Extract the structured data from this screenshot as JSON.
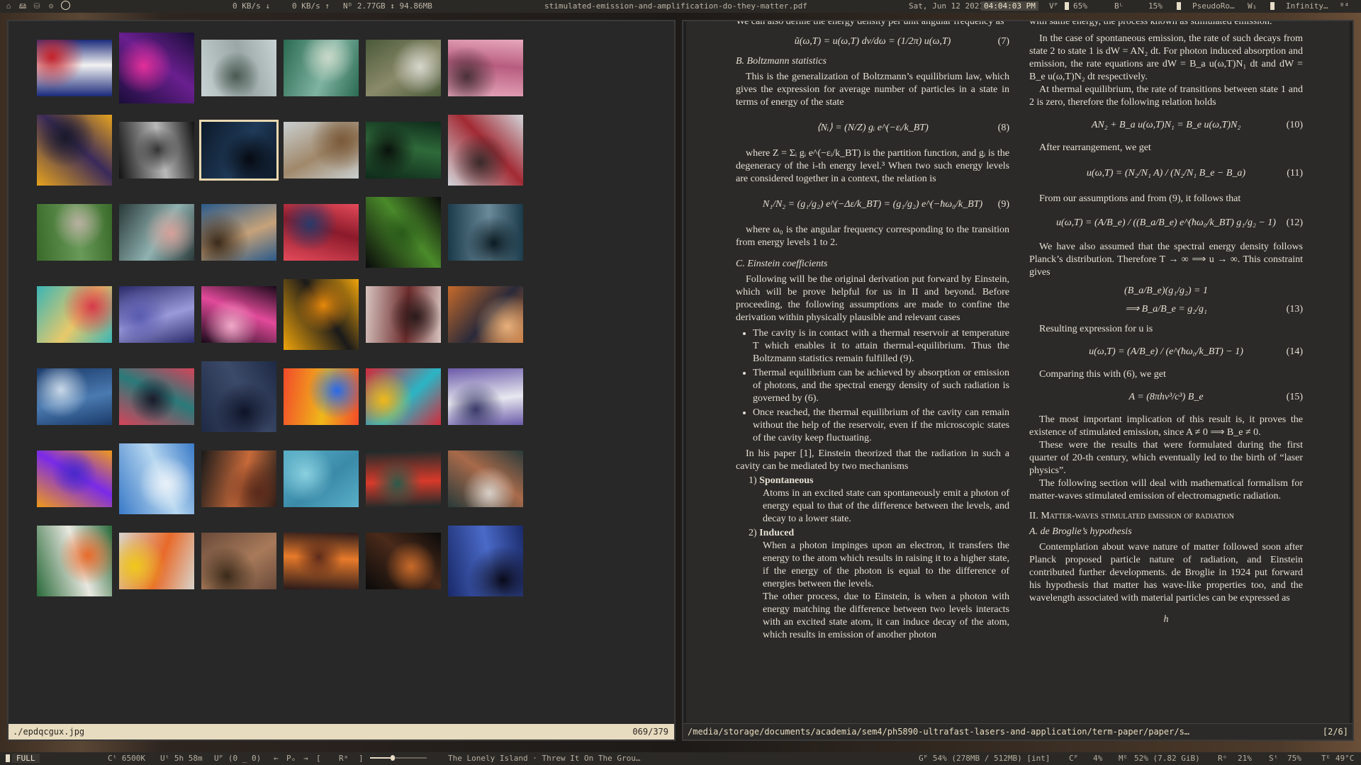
{
  "topbar": {
    "workspace_icons": [
      "⌂",
      "🖴",
      "⛁",
      "⚙"
    ],
    "net_down": "0 KB/s ↓",
    "net_up": "0 KB/s ↑",
    "disk": "Nᴰ 2.77GB ↕ 94.86MB",
    "window_title": "stimulated-emission-and-amplification-do-they-matter.pdf",
    "date": "Sat, Jun 12 2021",
    "time": "04:04:03 PM",
    "volume": "Vᴾ",
    "volume_pct": "65%",
    "brightness": "Bᴸ",
    "brightness_pct": "15%",
    "layout_name": "PseudoRo…",
    "layout_key": "W₁",
    "wm_mode": "Infinity…",
    "battery": "ᴮ⁴"
  },
  "thumbnails": [
    {
      "c1": "#1b2a7a",
      "c2": "#f2f2f2",
      "c3": "#c4212a"
    },
    {
      "c1": "#1a0d3a",
      "c2": "#6a1f8f",
      "c3": "#e22f9a"
    },
    {
      "c1": "#c8d2d4",
      "c2": "#9aa7a6",
      "c3": "#4a5a52"
    },
    {
      "c1": "#2a6a52",
      "c2": "#7fb3a2",
      "c3": "#c9d8c8"
    },
    {
      "c1": "#4a5a3a",
      "c2": "#8a8a6a",
      "c3": "#d6d6cc"
    },
    {
      "c1": "#e7a8bc",
      "c2": "#b85c7e",
      "c3": "#4a3038"
    },
    {
      "c1": "#e6a31e",
      "c2": "#3a2a5a",
      "c3": "#1a1a2a"
    },
    {
      "c1": "#111111",
      "c2": "#b9b9b9",
      "c3": "#333333"
    },
    {
      "c1": "#0d1a2a",
      "c2": "#1f3a58",
      "c3": "#060a12"
    },
    {
      "c1": "#c9cfd0",
      "c2": "#a0886a",
      "c3": "#7a5a3a"
    },
    {
      "c1": "#0e2a1a",
      "c2": "#2f6a3a",
      "c3": "#0a120c"
    },
    {
      "c1": "#d2d6da",
      "c2": "#a22a34",
      "c3": "#3a2a2a"
    },
    {
      "c1": "#3a6a2a",
      "c2": "#6a9a5a",
      "c3": "#b8b0a0"
    },
    {
      "c1": "#2a3a3a",
      "c2": "#8fb2b0",
      "c3": "#d7a19a"
    },
    {
      "c1": "#2a5a8a",
      "c2": "#c6a27a",
      "c3": "#3a2a1a"
    },
    {
      "c1": "#e44a5a",
      "c2": "#8a1a2a",
      "c3": "#2a3a6a"
    },
    {
      "c1": "#0a0a0a",
      "c2": "#4a8a2a",
      "c3": "#2a5a1a"
    },
    {
      "c1": "#1a3a4a",
      "c2": "#6a8a9a",
      "c3": "#0a1a22"
    },
    {
      "c1": "#3ab5b5",
      "c2": "#e9c96a",
      "c3": "#d63a4a"
    },
    {
      "c1": "#2a2a6a",
      "c2": "#9a9ada",
      "c3": "#5a5ab0"
    },
    {
      "c1": "#1a0a1a",
      "c2": "#e24a9a",
      "c3": "#f0a8c8"
    },
    {
      "c1": "#f0a40a",
      "c2": "#1a1a1a",
      "c3": "#e88a0a"
    },
    {
      "c1": "#d8c4c0",
      "c2": "#6a2a2a",
      "c3": "#2a1a1a"
    },
    {
      "c1": "#c66a2a",
      "c2": "#2a2a3a",
      "c3": "#e8b07a"
    },
    {
      "c1": "#1a3a6a",
      "c2": "#4a7ab0",
      "c3": "#c8d8e8"
    },
    {
      "c1": "#d4445a",
      "c2": "#2a7a7a",
      "c3": "#1a1a2a"
    },
    {
      "c1": "#1e2a44",
      "c2": "#3c4a6a",
      "c3": "#0e1428"
    },
    {
      "c1": "#f24a2a",
      "c2": "#f0b81a",
      "c3": "#2a6ae8"
    },
    {
      "c1": "#d42a3a",
      "c2": "#2ab5c5",
      "c3": "#f0b81a"
    },
    {
      "c1": "#6a5aa8",
      "c2": "#e8e8f0",
      "c3": "#3a3a6a"
    },
    {
      "c1": "#f09a1a",
      "c2": "#7a2ae8",
      "c3": "#4a2ac8"
    },
    {
      "c1": "#3a7ac8",
      "c2": "#b8d8f0",
      "c3": "#e8f0f8"
    },
    {
      "c1": "#1a1a1a",
      "c2": "#c86a3a",
      "c3": "#5a2a1a"
    },
    {
      "c1": "#5ab0c8",
      "c2": "#3a8aa8",
      "c3": "#8ad0e0"
    },
    {
      "c1": "#1a2a2a",
      "c2": "#d83a2a",
      "c3": "#2a5a4a"
    },
    {
      "c1": "#2a3a3a",
      "c2": "#a86a4a",
      "c3": "#d8d0c8"
    },
    {
      "c1": "#2a6a3a",
      "c2": "#e8e8e0",
      "c3": "#e86a2a"
    },
    {
      "c1": "#d8d4cc",
      "c2": "#e86a2a",
      "c3": "#f0c81a"
    },
    {
      "c1": "#6a4a3a",
      "c2": "#a87a5a",
      "c3": "#3a2a1a"
    },
    {
      "c1": "#2a1a1a",
      "c2": "#e87a2a",
      "c3": "#5a2a1a"
    },
    {
      "c1": "#0a0a0a",
      "c2": "#4a2a1a",
      "c3": "#c86a2a"
    },
    {
      "c1": "#1a2a6a",
      "c2": "#4a6ac8",
      "c3": "#0a0a1a"
    }
  ],
  "sxiv": {
    "filename": "./epdqcgux.jpg",
    "counter": "069/379"
  },
  "pdf": {
    "left_col": {
      "top_lines": "We can also define the energy density per unit angular frequency as",
      "eq7": "ũ(ω,T) = u(ω,T) dν/dω = (1/2π) u(ω,T)",
      "eq7_num": "(7)",
      "secB": "B. Boltzmann statistics",
      "pB": "This is the generalization of Boltzmann’s equilibrium law, which gives the expression for average number of particles in a state in terms of energy of the state",
      "eq8": "⟨Nᵢ⟩ = (N/Z) gᵢ e^(−εᵢ/k_BT)",
      "eq8_num": "(8)",
      "pZ": "where Z = Σᵢ gᵢ e^(−εᵢ/k_BT) is the partition function, and gᵢ is the degeneracy of the i-th energy level.³ When two such energy levels are considered together in a context, the relation is",
      "eq9": "N₁/N₂ = (g₁/g₂) e^(−Δε/k_BT) = (g₁/g₂) e^(−ħω₀/k_BT)",
      "eq9_num": "(9)",
      "pOmega": "where ω₀ is the angular frequency corresponding to the transition from energy levels 1 to 2.",
      "secC": "C. Einstein coefficients",
      "pC": "Following will be the original derivation put forward by Einstein, which will be prove helpful for us in II and beyond. Before proceeding, the following assumptions are made to confine the derivation within physically plausible and relevant cases",
      "bullets": [
        "The cavity is in contact with a thermal reservoir at temperature T which enables it to attain thermal-equilibrium. Thus the Boltzmann statistics remain fulfilled (9).",
        "Thermal equilibrium can be achieved by absorption or emission of photons, and the spectral energy density of such radiation is governed by (6).",
        "Once reached, the thermal equilibrium of the cavity can remain without the help of the reservoir, even if the microscopic states of the cavity keep fluctuating."
      ],
      "pPaper": "In his paper [1], Einstein theorized that the radiation in such a cavity can be mediated by two mechanisms",
      "enum1_num": "1)",
      "enum1_title": "Spontaneous",
      "enum1_body": "Atoms in an excited state can spontaneously emit a photon of energy equal to that of the difference between the levels, and decay to a lower state.",
      "enum2_num": "2)",
      "enum2_title": "Induced",
      "enum2_body": "When a photon impinges upon an electron, it transfers the energy to the atom which results in raising it to a higher state, if the energy of the photon is equal to the difference of energies between the levels.",
      "enum2_body2": "The other process, due to Einstein, is when a photon with energy matching the difference between two levels interacts with an excited state atom, it can induce decay of the atom, which results in emission of another photon"
    },
    "right_col": {
      "top_lines": "with same energy, the process known as stimulated emission.",
      "p1": "In the case of spontaneous emission, the rate of such decays from state 2 to state 1 is dW = AN₂ dt. For photon induced absorption and emission, the rate equations are dW = B_a u(ω,T)N₁ dt and dW = B_e u(ω,T)N₂ dt respectively.",
      "p2": "At thermal equilibrium, the rate of transitions between state 1 and 2 is zero, therefore the following relation holds",
      "eq10": "AN₂ + B_a u(ω,T)N₁ = B_e u(ω,T)N₂",
      "eq10_num": "(10)",
      "p3": "After rearrangement, we get",
      "eq11": "u(ω,T) = (N₂/N₁ A) / (N₂/N₁ B_e − B_a)",
      "eq11_num": "(11)",
      "p4": "From our assumptions and from (9), it follows that",
      "eq12": "u(ω,T) = (A/B_e) / ((B_a/B_e) e^(ħω₀/k_BT) g₁/g₂ − 1)",
      "eq12_num": "(12)",
      "p5": "We have also assumed that the spectral energy density follows Planck’s distribution. Therefore T → ∞ ⟹ u → ∞. This constraint gives",
      "eq13a": "(B_a/B_e)(g₁/g₂) = 1",
      "eq13b": "⟹ B_a/B_e = g₂/g₁",
      "eq13_num": "(13)",
      "p6": "Resulting expression for u is",
      "eq14": "u(ω,T) = (A/B_e) / (e^(ħω₀/k_BT) − 1)",
      "eq14_num": "(14)",
      "p7": "Comparing this with (6), we get",
      "eq15": "A = (8πhν³/c³) B_e",
      "eq15_num": "(15)",
      "p8": "The most important implication of this result is, it proves the existence of stimulated emission, since A ≠ 0 ⟹ B_e ≠ 0.",
      "p9": "These were the results that were formulated during the first quarter of 20-th century, which eventually led to the birth of “laser physics”.",
      "p10": "The following section will deal with mathematical formalism for matter-waves stimulated emission of electromagnetic radiation.",
      "secII": "II. Matter-waves stimulated emission of radiation",
      "secA": "A. de Broglie’s hypothesis",
      "p11": "Contemplation about wave nature of matter followed soon after Planck proposed particle nature of radiation, and Einstein contributed further developments. de Broglie in 1924 put forward his hypothesis that matter has wave-like properties too, and the wavelength associated with material particles can be expressed as",
      "eq_tail": "h"
    },
    "status_path": "/media/storage/documents/academia/sem4/ph5890-ultrafast-lasers-and-application/term-paper/paper/s…",
    "status_page": "[2/6]"
  },
  "bottombar": {
    "mode": "FULL",
    "color_temp": "Cᵗ 6500K",
    "uptime": "Uᵗ 5h 58m",
    "updates": "Uᴾ (0 _ 0)",
    "player_prev": "←",
    "player_label": "Pₒ",
    "player_next": "→",
    "repeat": "[",
    "repeat2": "Rᵃ",
    "repeat3": "]",
    "progress": 0.4,
    "track": "The Lonely Island · Threw It On The Grou…",
    "gpu": "Gᴾ 54% (278MB / 512MB) [int]",
    "cpu": "Cᴾ",
    "cpu_pct": "4%",
    "mem": "Mᴱ",
    "mem_val": "52% (7.82 GiB)",
    "root": "Rᵒ",
    "root_val": "21%",
    "storage": "Sᵗ",
    "storage_val": "75%",
    "temp": "Tᴱ 49°C"
  },
  "colors": {
    "accent": "#e8dcc0",
    "background": "#282828",
    "page": "#2b2a28"
  }
}
